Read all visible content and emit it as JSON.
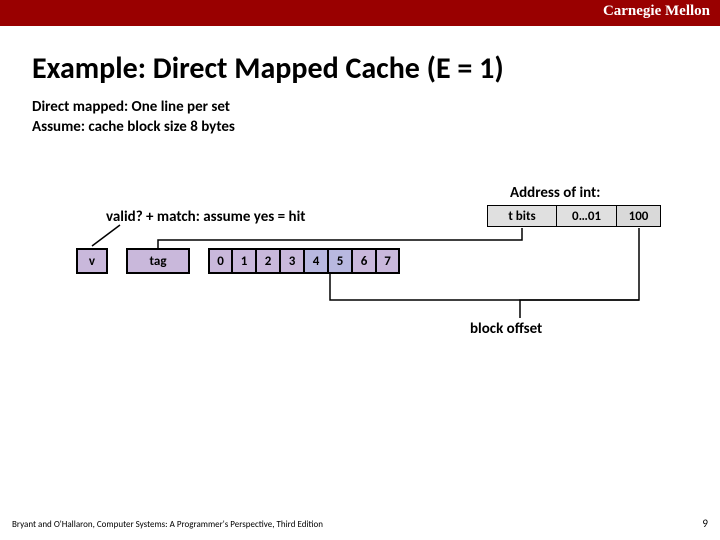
{
  "brand": "Carnegie Mellon",
  "title": "Example: Direct Mapped Cache (E = 1)",
  "subtitle_line1": "Direct mapped: One line per set",
  "subtitle_line2": "Assume: cache block size 8 bytes",
  "hit_text": "valid?   +   match: assume yes = hit",
  "address": {
    "heading": "Address of int:",
    "tbits": "t bits",
    "setidx": "0…01",
    "offset": "100"
  },
  "cache": {
    "v": "v",
    "tag": "tag",
    "bytes": [
      "0",
      "1",
      "2",
      "3",
      "4",
      "5",
      "6",
      "7"
    ],
    "highlight_start": 4,
    "highlight_end": 5
  },
  "block_offset_label": "block offset",
  "footer": "Bryant and O'Hallaron, Computer Systems: A Programmer's Perspective, Third Edition",
  "page": "9"
}
